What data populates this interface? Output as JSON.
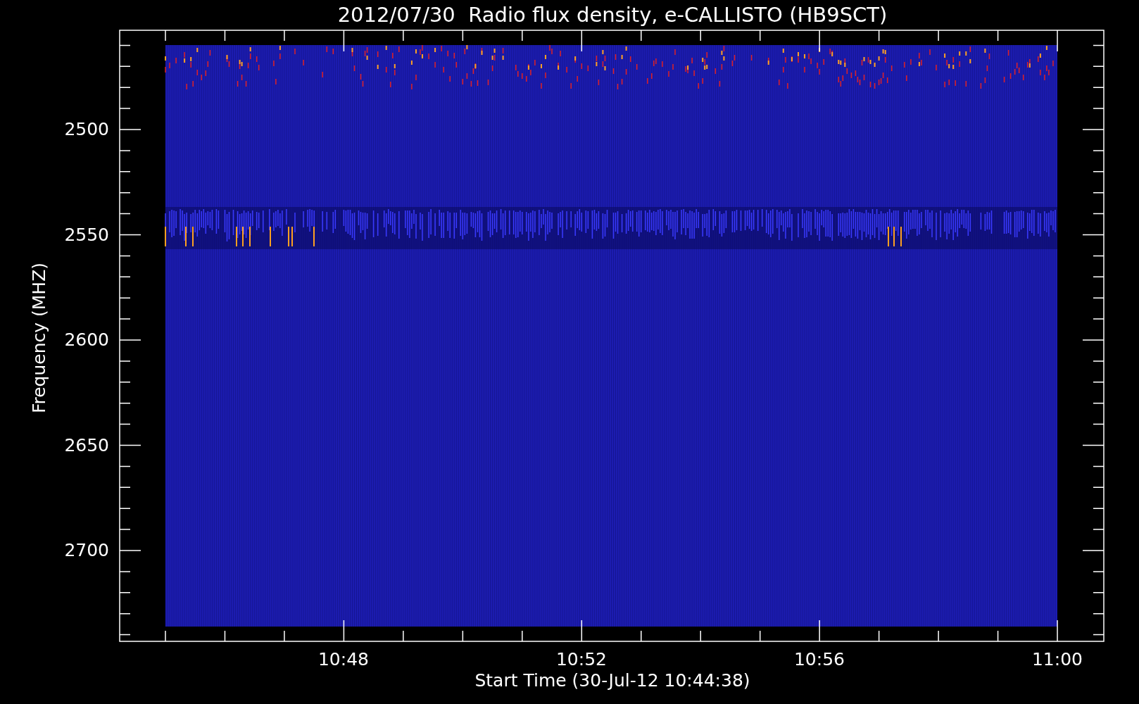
{
  "title": "2012/07/30  Radio flux density, e-CALLISTO (HB9SCT)",
  "ylabel": "Frequency (MHZ)",
  "yticks": [
    "2500",
    "2550",
    "2600",
    "2650",
    "2700"
  ],
  "xticks": [
    "10:48",
    "10:52",
    "10:56",
    "11:00"
  ],
  "xlabel": "Start Time (30-Jul-12 10:44:38)"
}
